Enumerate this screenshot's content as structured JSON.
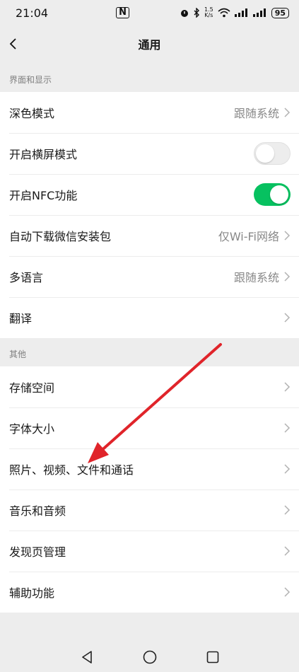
{
  "status": {
    "time": "21:04",
    "nfc": "N",
    "speed_top": "1.5",
    "speed_bottom": "K/s",
    "battery": "95"
  },
  "header": {
    "title": "通用"
  },
  "sections": {
    "display": {
      "label": "界面和显示"
    },
    "other": {
      "label": "其他"
    }
  },
  "rows": {
    "dark_mode": {
      "label": "深色模式",
      "value": "跟随系统"
    },
    "landscape": {
      "label": "开启横屏模式",
      "enabled": false
    },
    "nfc": {
      "label": "开启NFC功能",
      "enabled": true
    },
    "auto_download": {
      "label": "自动下载微信安装包",
      "value": "仅Wi-Fi网络"
    },
    "language": {
      "label": "多语言",
      "value": "跟随系统"
    },
    "translate": {
      "label": "翻译"
    },
    "storage": {
      "label": "存储空间"
    },
    "font_size": {
      "label": "字体大小"
    },
    "media": {
      "label": "照片、视频、文件和通话"
    },
    "music": {
      "label": "音乐和音频"
    },
    "discover": {
      "label": "发现页管理"
    },
    "accessibility": {
      "label": "辅助功能"
    }
  },
  "colors": {
    "accent": "#07c160",
    "annotation_arrow": "#e0242a",
    "background": "#ededed"
  },
  "icons": [
    "back-icon",
    "chevron-right-icon",
    "nav-back-icon",
    "nav-home-icon",
    "nav-recents-icon"
  ]
}
